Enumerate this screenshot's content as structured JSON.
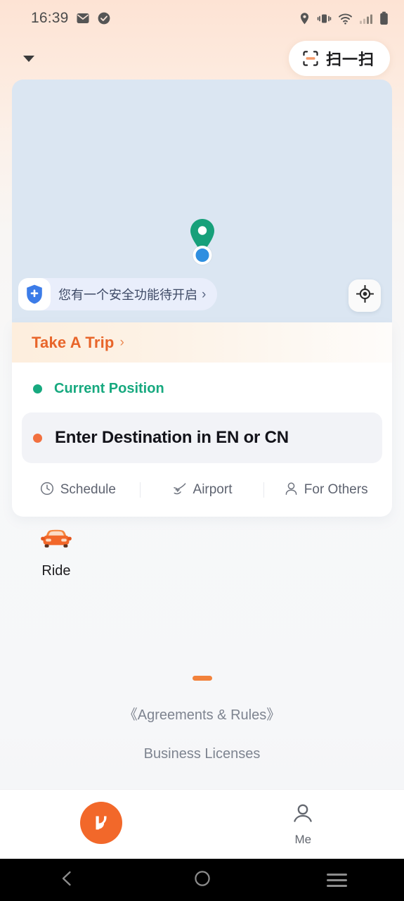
{
  "status_bar": {
    "time": "16:39",
    "left_icons": [
      "mail-icon",
      "check-circle-icon"
    ],
    "right_icons": [
      "location-icon",
      "vibrate-icon",
      "wifi-icon",
      "signal-icon",
      "battery-icon"
    ]
  },
  "header": {
    "dropdown_icon": "caret-down-icon",
    "scan": {
      "label": "扫一扫",
      "icon": "scan-code-icon"
    }
  },
  "map": {
    "pin_icon": "map-pin-icon",
    "current_location_icon": "current-location-dot",
    "safety_banner": {
      "icon": "shield-plus-icon",
      "text": "您有一个安全功能待开启",
      "chevron": "›"
    },
    "locate_button": {
      "icon": "crosshair-icon"
    }
  },
  "trip_card": {
    "title": "Take A Trip",
    "title_chevron": "›",
    "origin": {
      "label": "Current Position",
      "dot_color": "#17a97f"
    },
    "destination": {
      "placeholder": "Enter Destination in EN or CN",
      "dot_color": "#f2703f"
    },
    "quick_actions": [
      {
        "label": "Schedule",
        "icon": "clock-icon"
      },
      {
        "label": "Airport",
        "icon": "airplane-icon"
      },
      {
        "label": "For Others",
        "icon": "person-icon"
      }
    ]
  },
  "services": [
    {
      "label": "Ride",
      "icon": "car-icon"
    }
  ],
  "footer": {
    "divider_icon": "orange-dash",
    "links": [
      "《Agreements & Rules》",
      "Business Licenses"
    ]
  },
  "tab_bar": [
    {
      "label": "",
      "icon": "didi-logo-icon",
      "active": true
    },
    {
      "label": "Me",
      "icon": "person-outline-icon",
      "active": false
    }
  ],
  "android_nav": {
    "back": "back-chevron-icon",
    "home": "home-circle-icon",
    "recents": "recents-menu-icon"
  },
  "colors": {
    "brand_orange": "#f2682a",
    "title_orange": "#e8652a",
    "green": "#17a97f",
    "map_blue": "#dbe6f2",
    "field_gray": "#f2f3f7"
  }
}
